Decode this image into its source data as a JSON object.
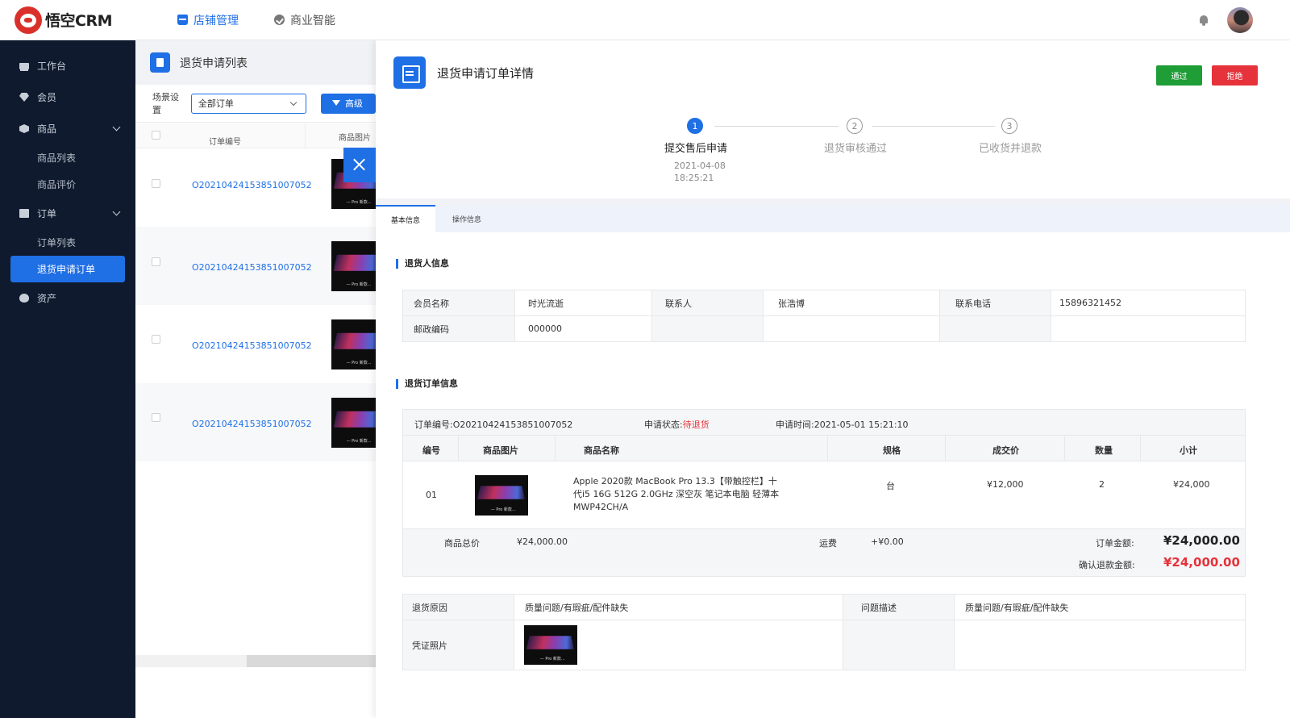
{
  "app": {
    "name": "悟空CRM"
  },
  "topnav": [
    {
      "label": "店铺管理",
      "icon": "store-icon",
      "active": true
    },
    {
      "label": "商业智能",
      "icon": "bi-icon",
      "active": false
    }
  ],
  "sidebar": {
    "items": [
      {
        "label": "工作台",
        "icon": "desktop-icon"
      },
      {
        "label": "会员",
        "icon": "gem-icon"
      },
      {
        "label": "商品",
        "icon": "box-icon"
      },
      {
        "label": "订单",
        "icon": "order-icon"
      },
      {
        "label": "资产",
        "icon": "asset-icon"
      }
    ],
    "goods_sub": [
      "商品列表",
      "商品评价"
    ],
    "order_sub": [
      "订单列表",
      "退货申请订单"
    ]
  },
  "list": {
    "title": "退货申请列表",
    "filter_label": "场景设置",
    "filter_value": "全部订单",
    "advanced_label": "高级",
    "col_order_no": "订单编号",
    "col_image": "商品图片",
    "rows": [
      {
        "order_no": "O20210424153851007052"
      },
      {
        "order_no": "O20210424153851007052"
      },
      {
        "order_no": "O20210424153851007052"
      },
      {
        "order_no": "O20210424153851007052"
      }
    ]
  },
  "detail": {
    "title": "退货申请订单详情",
    "pass_label": "通过",
    "reject_label": "拒绝",
    "steps": [
      {
        "num": "1",
        "label": "提交售后申请",
        "date": "2021-04-08",
        "time": "18:25:21"
      },
      {
        "num": "2",
        "label": "退货审核通过"
      },
      {
        "num": "3",
        "label": "已收货并退款"
      }
    ],
    "tabs": [
      "基本信息",
      "操作信息"
    ],
    "returner_section": "退货人信息",
    "returner": {
      "member_label": "会员名称",
      "member": "时光流逝",
      "contact_label": "联系人",
      "contact": "张浩博",
      "phone_label": "联系电话",
      "phone": "15896321452",
      "zip_label": "邮政编码",
      "zip": "000000"
    },
    "order_section": "退货订单信息",
    "order": {
      "order_no_text": "订单编号:O20210424153851007052",
      "status_label": "申请状态:",
      "status": "待退货",
      "apply_time_text": "申请时间:2021-05-01  15:21:10",
      "headers": [
        "编号",
        "商品图片",
        "商品名称",
        "规格",
        "成交价",
        "数量",
        "小计"
      ],
      "item": {
        "no": "01",
        "name": "Apple 2020款 MacBook Pro 13.3【带触控栏】十代i5 16G 512G 2.0GHz 深空灰 笔记本电脑 轻薄本 MWP42CH/A",
        "spec": "台",
        "price": "¥12,000",
        "qty": "2",
        "subtotal": "¥24,000"
      },
      "goods_total_label": "商品总价",
      "goods_total": "¥24,000.00",
      "freight_label": "运费",
      "freight": "+¥0.00",
      "order_amount_label": "订单金额:",
      "order_amount": "¥24,000.00",
      "refund_label": "确认退款金额:",
      "refund": "¥24,000.00"
    },
    "reason": {
      "reason_label": "退货原因",
      "reason": "质量问题/有瑕疵/配件缺失",
      "desc_label": "问题描述",
      "desc": "质量问题/有瑕疵/配件缺失",
      "photo_label": "凭证照片"
    }
  },
  "colors": {
    "primary": "#1f6fe5",
    "sidebar": "#0f1a2e",
    "pass": "#1f9d36",
    "reject": "#e6323a"
  }
}
